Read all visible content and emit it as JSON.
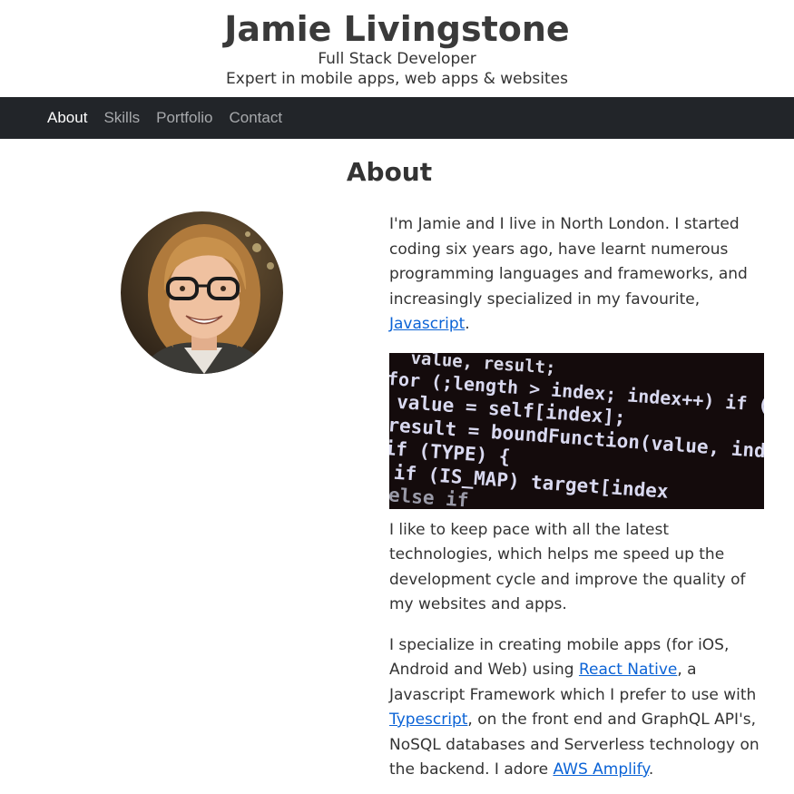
{
  "header": {
    "name": "Jamie Livingstone",
    "role": "Full Stack Developer",
    "tagline": "Expert in mobile apps, web apps & websites"
  },
  "nav": {
    "items": [
      {
        "label": "About",
        "active": true
      },
      {
        "label": "Skills",
        "active": false
      },
      {
        "label": "Portfolio",
        "active": false
      },
      {
        "label": "Contact",
        "active": false
      }
    ]
  },
  "about": {
    "title": "About",
    "p1_text": "I'm Jamie and I live in North London. I started coding six years ago, have learnt numerous programming languages and frameworks, and increasingly specialized in my favourite,",
    "p1_link": "Javascript",
    "p1_end": ".",
    "code_lines": [
      "  value, result;",
      "for (;length > index; index++) if (NO_HOL",
      " value = self[index];",
      " result = boundFunction(value, index, O);",
      " if (TYPE) {",
      "  if (IS_MAP) target[index",
      "  else if"
    ],
    "p2": "I like to keep pace with all the latest technologies, which helps me speed up the development cycle and improve the quality of my websites and apps.",
    "p3_a": "I specialize in creating mobile apps (for iOS, Android and Web) using",
    "p3_link1": "React Native",
    "p3_b": ", a Javascript Framework which I prefer to use with",
    "p3_link2": "Typescript",
    "p3_c": ", on the front end and GraphQL API's, NoSQL databases and Serverless technology on the backend. I adore",
    "p3_link3": "AWS Amplify",
    "p3_d": "."
  },
  "colors": {
    "navbar_bg": "#222529",
    "link": "#0b63d6",
    "nav_inactive": "#a7a9ac"
  }
}
